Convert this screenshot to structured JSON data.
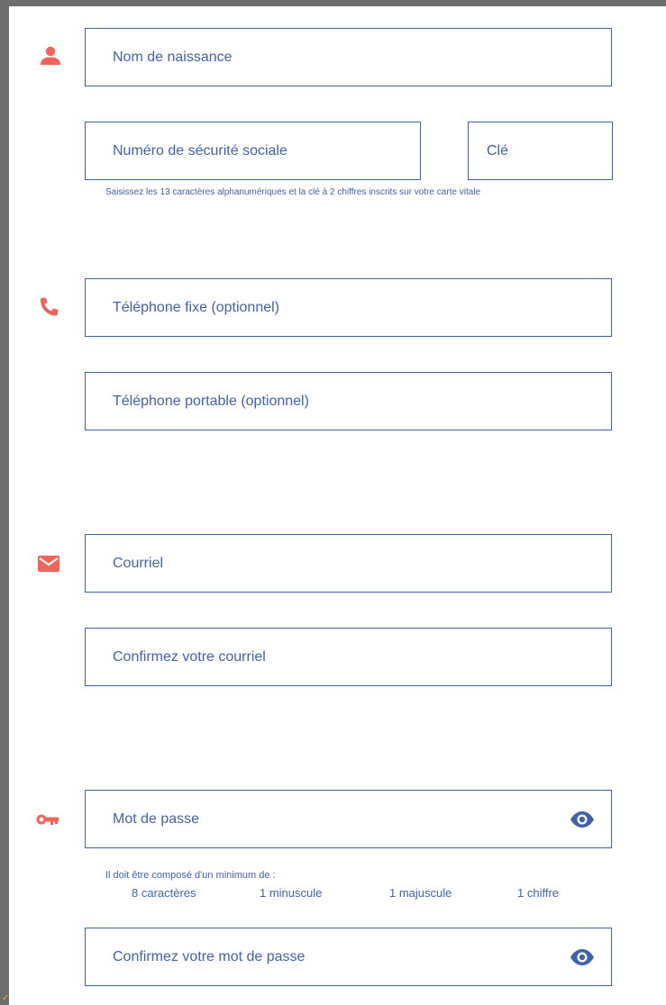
{
  "fields": {
    "birth_name": {
      "placeholder": "Nom de naissance"
    },
    "ssn": {
      "placeholder": "Numéro de sécurité sociale"
    },
    "ssn_key": {
      "placeholder": "Clé"
    },
    "phone_fixed": {
      "placeholder": "Téléphone fixe (optionnel)"
    },
    "phone_mobile": {
      "placeholder": "Téléphone portable (optionnel)"
    },
    "email": {
      "placeholder": "Courriel"
    },
    "email_confirm": {
      "placeholder": "Confirmez votre courriel"
    },
    "password": {
      "placeholder": "Mot de passe"
    },
    "password_confirm": {
      "placeholder": "Confirmez votre mot de passe"
    }
  },
  "ssn_help": "Saisissez les 13 caractères alphanumériques et la clé à 2 chiffres inscrits sur votre carte vitale",
  "password_rules": {
    "title": "Il doit être composé d'un minimum de :",
    "items": [
      "8 caractères",
      "1 minuscule",
      "1 majuscule",
      "1 chiffre"
    ]
  },
  "icons": {
    "identity": "person-icon",
    "phone": "phone-icon",
    "email": "envelope-icon",
    "password": "key-icon",
    "show_password": "eye-icon"
  },
  "colors": {
    "accent": "#f0645a",
    "field_border": "#3f63a9",
    "text": "#3f63a9",
    "frame": "#6e6e6e"
  }
}
